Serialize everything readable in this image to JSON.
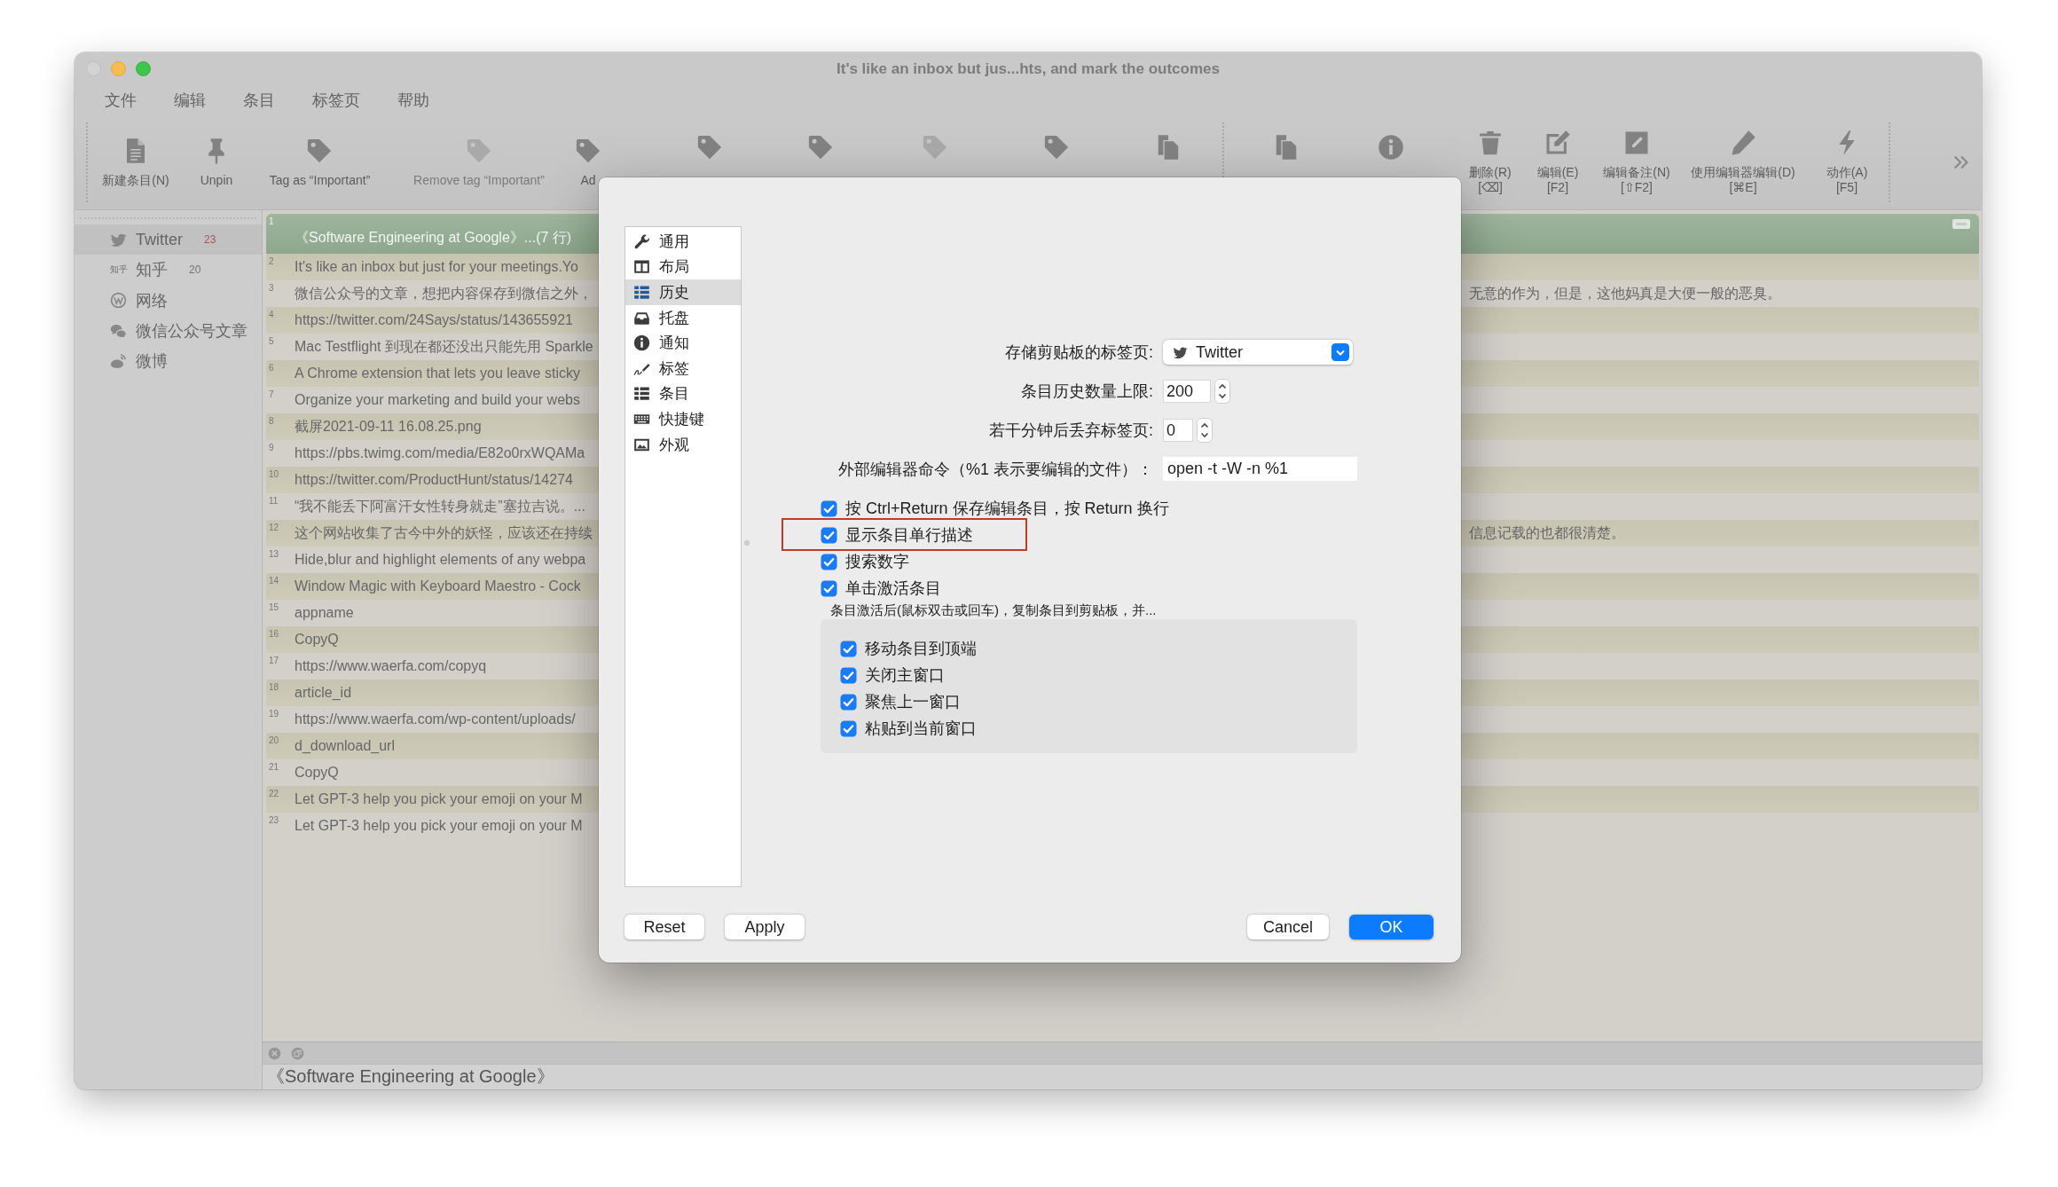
{
  "window": {
    "title": "It's like an inbox but jus...hts, and mark the outcomes"
  },
  "menu": [
    "文件",
    "编辑",
    "条目",
    "标签页",
    "帮助"
  ],
  "toolbar": [
    {
      "kind": "button",
      "label": "新建条目(N)",
      "disabled": false
    },
    {
      "kind": "button",
      "label": "Unpin",
      "disabled": false
    },
    {
      "kind": "button",
      "label": "Tag as “Important”",
      "disabled": false
    },
    {
      "kind": "button",
      "label": "Remove tag “Important”",
      "disabled": true
    },
    {
      "kind": "button",
      "label": "Ad",
      "disabled": false
    },
    {
      "kind": "button",
      "disabled": false
    },
    {
      "kind": "button",
      "disabled": false
    },
    {
      "kind": "button",
      "disabled": true
    },
    {
      "kind": "button",
      "disabled": false
    },
    {
      "kind": "button",
      "disabled": false
    },
    {
      "kind": "separator"
    },
    {
      "kind": "button",
      "disabled": false
    },
    {
      "kind": "button",
      "disabled": false
    },
    {
      "kind": "button",
      "label": "删除(R)",
      "shortcut": "[⌫]",
      "disabled": false
    },
    {
      "kind": "button",
      "label": "编辑(E)",
      "shortcut": "[F2]",
      "disabled": false
    },
    {
      "kind": "button",
      "label": "编辑备注(N)",
      "shortcut": "[⇧F2]",
      "disabled": false
    },
    {
      "kind": "button",
      "label": "使用编辑器编辑(D)",
      "shortcut": "[⌘E]",
      "disabled": false
    },
    {
      "kind": "button",
      "label": "动作(A)",
      "shortcut": "[F5]",
      "disabled": false
    },
    {
      "kind": "separator"
    },
    {
      "kind": "overflow"
    }
  ],
  "sidebar": {
    "tabs": [
      {
        "label": "Twitter",
        "count": "23",
        "selected": true
      },
      {
        "label": "知乎",
        "icon_text": "知乎",
        "count": "20",
        "selected": false
      },
      {
        "label": "网络",
        "selected": false
      },
      {
        "label": "微信公众号文章",
        "selected": false
      },
      {
        "label": "微博",
        "selected": false
      }
    ]
  },
  "list": {
    "rows": [
      {
        "number": "1",
        "text": "《Software Engineering at Google》...(7 行)",
        "selected": true,
        "tagged": true
      },
      {
        "number": "2",
        "text": "It's like an inbox but just for your meetings.Yo",
        "selected": false,
        "tagged": false
      },
      {
        "number": "3",
        "text": "微信公众号的文章，想把内容保存到微信之外，",
        "tail": "无意的作为，但是，这他妈真是大便一般的恶臭。",
        "selected": false,
        "tagged": false
      },
      {
        "number": "4",
        "text": "https://twitter.com/24Says/status/143655921",
        "selected": false,
        "tagged": false
      },
      {
        "number": "5",
        "text": "Mac Testflight 到现在都还没出只能先用 Sparkle",
        "selected": false,
        "tagged": false
      },
      {
        "number": "6",
        "text": "A Chrome extension that lets you leave sticky",
        "selected": false,
        "tagged": false
      },
      {
        "number": "7",
        "text": "Organize your marketing and build your webs",
        "selected": false,
        "tagged": false
      },
      {
        "number": "8",
        "text": "截屏2021-09-11 16.08.25.png",
        "selected": false,
        "tagged": false
      },
      {
        "number": "9",
        "text": "https://pbs.twimg.com/media/E82o0rxWQAMa",
        "selected": false,
        "tagged": false
      },
      {
        "number": "10",
        "text": "https://twitter.com/ProductHunt/status/14274",
        "selected": false,
        "tagged": false
      },
      {
        "number": "11",
        "text": "“我不能丢下阿富汗女性转身就走”塞拉吉说。...",
        "selected": false,
        "tagged": false
      },
      {
        "number": "12",
        "text": "这个网站收集了古今中外的妖怪，应该还在持续",
        "tail": "信息记载的也都很清楚。",
        "selected": false,
        "tagged": false
      },
      {
        "number": "13",
        "text": "Hide,blur and highlight elements of any webpa",
        "selected": false,
        "tagged": false
      },
      {
        "number": "14",
        "text": "Window Magic with Keyboard Maestro - Cock",
        "selected": false,
        "tagged": false
      },
      {
        "number": "15",
        "text": "appname",
        "selected": false,
        "tagged": false
      },
      {
        "number": "16",
        "text": "CopyQ",
        "selected": false,
        "tagged": false
      },
      {
        "number": "17",
        "text": "https://www.waerfa.com/copyq",
        "selected": false,
        "tagged": false
      },
      {
        "number": "18",
        "text": "article_id",
        "selected": false,
        "tagged": false
      },
      {
        "number": "19",
        "text": "https://www.waerfa.com/wp-content/uploads/",
        "selected": false,
        "tagged": false
      },
      {
        "number": "20",
        "text": "d_download_url",
        "selected": false,
        "tagged": false
      },
      {
        "number": "21",
        "text": "CopyQ",
        "selected": false,
        "tagged": false
      },
      {
        "number": "22",
        "text": "Let GPT-3 help you pick your emoji on your M",
        "selected": false,
        "tagged": false
      },
      {
        "number": "23",
        "text": "Let GPT-3 help you pick your emoji on your M",
        "selected": false,
        "tagged": false
      }
    ]
  },
  "preview": {
    "text": "《Software Engineering at Google》"
  },
  "dialog": {
    "categories": [
      {
        "label": "通用",
        "selected": false
      },
      {
        "label": "布局",
        "selected": false
      },
      {
        "label": "历史",
        "selected": true
      },
      {
        "label": "托盘",
        "selected": false
      },
      {
        "label": "通知",
        "selected": false
      },
      {
        "label": "标签",
        "selected": false
      },
      {
        "label": "条目",
        "selected": false
      },
      {
        "label": "快捷键",
        "selected": false
      },
      {
        "label": "外观",
        "selected": false
      }
    ],
    "fields": [
      {
        "kind": "dropdown",
        "label": "存储剪贴板的标签页:",
        "value": "Twitter"
      },
      {
        "kind": "spinner",
        "label": "条目历史数量上限:",
        "value": "200"
      },
      {
        "kind": "spinner",
        "label": "若干分钟后丢弃标签页:",
        "value": "0"
      },
      {
        "kind": "text",
        "label": "外部编辑器命令（%1 表示要编辑的文件）：",
        "value": "open -t -W -n %1"
      }
    ],
    "options": [
      {
        "label": "按 Ctrl+Return 保存编辑条目，按 Return 换行",
        "checked": true,
        "highlighted": false
      },
      {
        "label": "显示条目单行描述",
        "checked": true,
        "highlighted": true
      },
      {
        "label": "搜索数字",
        "checked": true,
        "highlighted": false
      },
      {
        "label": "单击激活条目",
        "checked": true,
        "highlighted": false
      }
    ],
    "activation_note": "条目激活后(鼠标双击或回车)，复制条目到剪贴板，并...",
    "activation_options": [
      {
        "label": "移动条目到顶端",
        "checked": true
      },
      {
        "label": "关闭主窗口",
        "checked": true
      },
      {
        "label": "聚焦上一窗口",
        "checked": true
      },
      {
        "label": "粘贴到当前窗口",
        "checked": true
      }
    ],
    "buttons_left": [
      {
        "label": "Reset",
        "default": false
      },
      {
        "label": "Apply",
        "default": false
      }
    ],
    "buttons_right": [
      {
        "label": "Cancel",
        "default": false
      },
      {
        "label": "OK",
        "default": true
      }
    ]
  }
}
